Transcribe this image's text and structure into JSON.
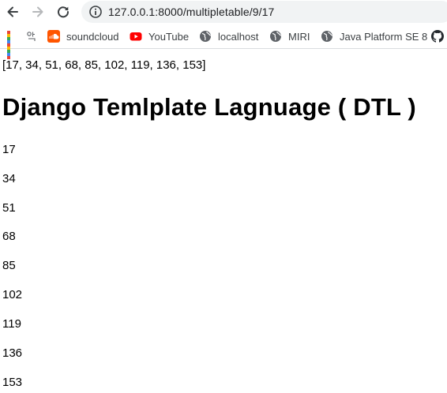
{
  "browser": {
    "url": "127.0.0.1:8000/multipletable/9/17",
    "bookmarks": [
      {
        "label": "",
        "icon": "apps-grid-icon"
      },
      {
        "label": "soundcloud",
        "icon": "soundcloud-icon"
      },
      {
        "label": "YouTube",
        "icon": "youtube-icon"
      },
      {
        "label": "localhost",
        "icon": "globe-icon"
      },
      {
        "label": "MIRI",
        "icon": "globe-icon"
      },
      {
        "label": "Java Platform SE 8",
        "icon": "globe-icon"
      }
    ],
    "colors": {
      "soundcloud": "#ff5500",
      "youtube": "#ff0000",
      "globe": "#5f6368"
    }
  },
  "page": {
    "array_text": "[17, 34, 51, 68, 85, 102, 119, 136, 153]",
    "heading": "Django Temlplate Lagnuage ( DTL )",
    "values": [
      "17",
      "34",
      "51",
      "68",
      "85",
      "102",
      "119",
      "136",
      "153"
    ]
  }
}
